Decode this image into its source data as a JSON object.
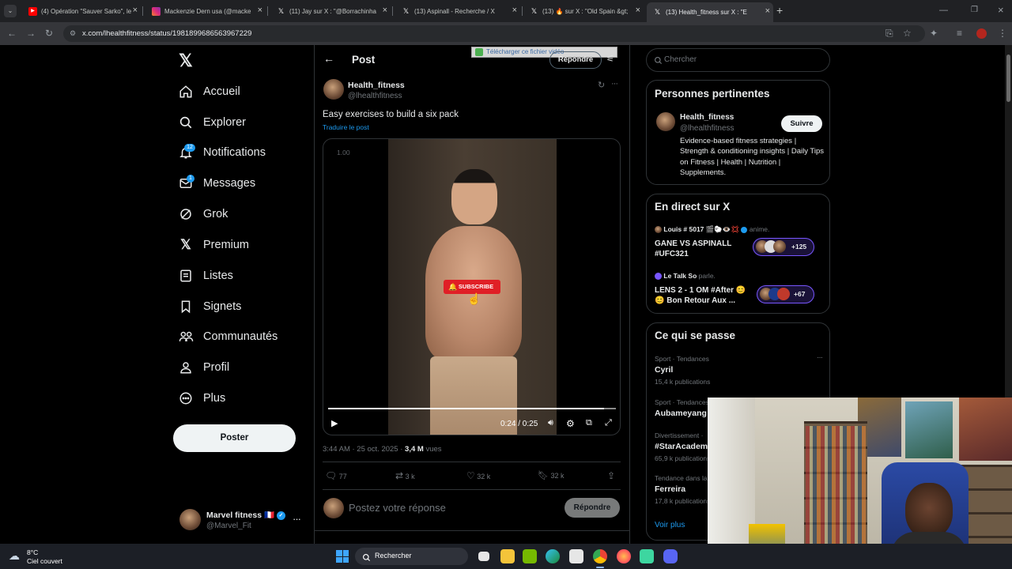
{
  "browser": {
    "tabs": [
      {
        "label": "(4) Opération \"Sauver Sarko\", le",
        "favicon": "youtube-icon"
      },
      {
        "label": "Mackenzie Dern usa (@macke",
        "favicon": "instagram-icon"
      },
      {
        "label": "(11) Jay sur X : \"@Borrachinha",
        "favicon": "x-icon"
      },
      {
        "label": "(13) Aspinall - Recherche / X",
        "favicon": "x-icon"
      },
      {
        "label": "(13) 🔥 sur X : \"Old Spain &gt;",
        "favicon": "x-icon"
      },
      {
        "label": "(13) Health_fitness sur X : \"E",
        "favicon": "x-icon"
      }
    ],
    "url": "x.com/lhealthfitness/status/1981899686563967229"
  },
  "sidebar": {
    "items": [
      {
        "label": "Accueil",
        "icon": "home-icon"
      },
      {
        "label": "Explorer",
        "icon": "search-icon"
      },
      {
        "label": "Notifications",
        "icon": "bell-icon",
        "badge": "12"
      },
      {
        "label": "Messages",
        "icon": "mail-icon",
        "badge": "1"
      },
      {
        "label": "Grok",
        "icon": "grok-icon"
      },
      {
        "label": "Premium",
        "icon": "x-logo-icon"
      },
      {
        "label": "Listes",
        "icon": "list-icon"
      },
      {
        "label": "Signets",
        "icon": "bookmark-icon"
      },
      {
        "label": "Communautés",
        "icon": "communities-icon"
      },
      {
        "label": "Profil",
        "icon": "profile-icon"
      },
      {
        "label": "Plus",
        "icon": "more-circle-icon"
      }
    ],
    "post_button": "Poster",
    "account": {
      "name": "Marvel fitness 🇫🇷",
      "handle": "@Marvel_Fit"
    }
  },
  "header": {
    "title": "Post",
    "reply_button": "Répondre",
    "download_bar": "Télécharger ce fichier vidéo"
  },
  "post": {
    "author": "Health_fitness",
    "handle": "@lhealthfitness",
    "text": "Easy exercises to build a six pack",
    "translate": "Traduire le post",
    "video": {
      "speed_label": "1.00",
      "time": "0:24 / 0:25",
      "progress": 0.96,
      "subscribe_label": "SUBSCRIBE"
    },
    "timestamp": "3:44 AM · 25 oct. 2025 · ",
    "views_count": "3,4 M",
    "views_label": " vues",
    "stats": {
      "replies": "77",
      "reposts": "3 k",
      "likes": "32 k",
      "bookmarks": "32 k"
    },
    "reply_placeholder": "Postez votre réponse",
    "reply_button": "Répondre"
  },
  "right": {
    "search_placeholder": "Chercher",
    "relevant": {
      "title": "Personnes pertinentes",
      "name": "Health_fitness",
      "handle": "@lhealthfitness",
      "follow": "Suivre",
      "bio": "Evidence-based fitness strategies | Strength & conditioning insights | Daily Tips on Fitness | Health | Nutrition | Supplements."
    },
    "live": {
      "title": "En direct sur X",
      "items": [
        {
          "host": "Louis # 5017 🎬🐑👁️💢",
          "verb": "anime.",
          "title": "GANE VS ASPINALL #UFC321",
          "count": "+125"
        },
        {
          "host": "Le Talk So",
          "verb": "parle.",
          "title": "LENS 2 - 1 OM #After 😊 😊 Bon Retour Aux ...",
          "count": "+67"
        }
      ]
    },
    "trends": {
      "title": "Ce qui se passe",
      "items": [
        {
          "category": "Sport · Tendances",
          "name": "Cyril",
          "count": "15,4 k publications"
        },
        {
          "category": "Sport · Tendances",
          "name": "Aubameyang",
          "count": ""
        },
        {
          "category": "Divertissement ·",
          "name": "#StarAcadem",
          "count": "65,9 k publications"
        },
        {
          "category": "Tendance dans la",
          "name": "Ferreira",
          "count": "17,8 k publications"
        }
      ],
      "more": "Voir plus"
    }
  },
  "taskbar": {
    "weather_temp": "8°C",
    "weather_desc": "Ciel couvert",
    "search": "Rechercher"
  },
  "colors": {
    "accent": "#1d9bf0",
    "bg": "#000000",
    "border": "#2f3336",
    "subscribe": "#e01f26"
  }
}
